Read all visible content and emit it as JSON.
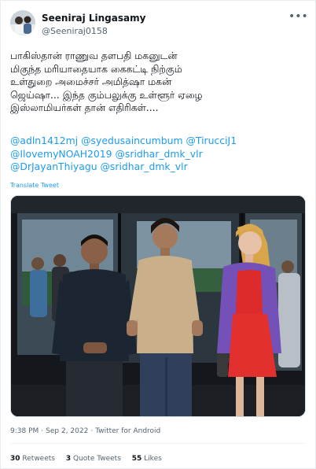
{
  "tweet": {
    "author_name": "Seeniraj Lingasamy",
    "author_handle": "@Seeniraj0158",
    "more_icon": "more-horizontal-icon",
    "text": "பாகிஸ்தான் ராணுவ தளபதி மகனுடன்\nமிகுந்த மரியாதையாக கைகட்டி நிற்கும்\nஉள்துறை அமைச்சர் அமித்ஷா மகன்\nஜெய்ஷா... இந்த கும்பலுக்கு உள்ளூர் ஏழை\nஇஸ்லாமியர்கள் தான் எதிரிகள்....",
    "mentions": [
      "@adln1412mj",
      "@syedusaincumbum",
      "@TirucciJ1",
      "@IlovemyNOAH2019",
      "@sridhar_dmk_vlr",
      "@DrJayanThiyagu",
      "@sridhar_dmk_vlr"
    ],
    "translate_label": "Translate Tweet",
    "time": "9:38 PM",
    "date": "Sep 2, 2022",
    "source": "Twitter for Android",
    "retweets_count": "30",
    "retweets_label": "Retweets",
    "quotes_count": "3",
    "quotes_label": "Quote Tweets",
    "likes_count": "55",
    "likes_label": "Likes"
  },
  "colors": {
    "link": "#1d9bf0",
    "secondary_text": "#536471",
    "primary_text": "#0f1419"
  }
}
